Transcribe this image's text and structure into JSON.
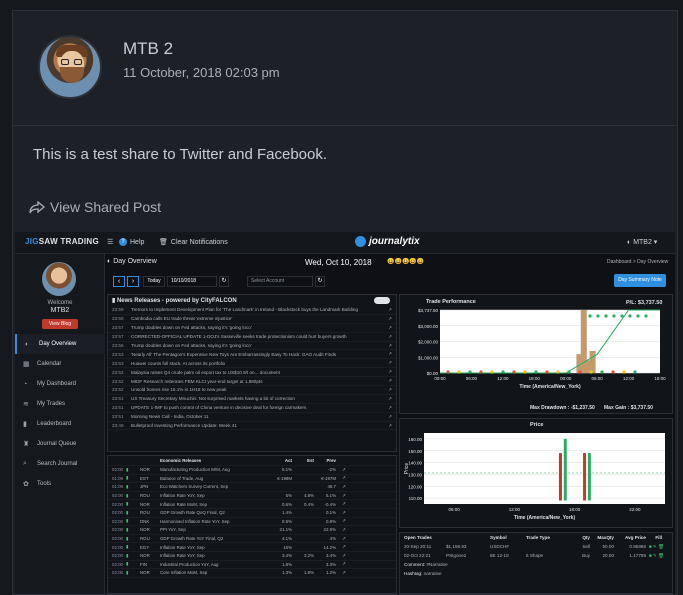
{
  "post": {
    "author": "MTB 2",
    "date": "11 October, 2018 02:03 pm",
    "message": "This is a test share to Twitter and Facebook.",
    "view_link": "View Shared Post"
  },
  "app": {
    "brand_a": "JIG",
    "brand_b": "SAW TRADING",
    "help": "Help",
    "clear": "Clear Notifications",
    "journal": "journalytix",
    "user": "MTB2"
  },
  "sidebar": {
    "welcome": "Welcome",
    "name": "MTB2",
    "btn": "View Blog",
    "items": [
      {
        "label": "Day Overview",
        "icon": "◐"
      },
      {
        "label": "Calendar",
        "icon": "▦"
      },
      {
        "label": "My Dashboard",
        "icon": "◔"
      },
      {
        "label": "My Trades",
        "icon": "≋"
      },
      {
        "label": "Leaderboard",
        "icon": "▮"
      },
      {
        "label": "Journal Queue",
        "icon": "♜"
      },
      {
        "label": "Search Journal",
        "icon": "⌕"
      },
      {
        "label": "Tools",
        "icon": "✿"
      }
    ]
  },
  "day": {
    "title": "Day Overview",
    "date": "Wed, Oct 10, 2018",
    "today": "Today",
    "date_input": "10/10/2018",
    "account_placeholder": "Select Account",
    "summary_btn": "Day Summary Note",
    "breadcrumb": "Dashboard > Day Overview",
    "emoji": "😀😀😀😀😀"
  },
  "news": {
    "title": "News Releases - powered by CityFALCON",
    "rows": [
      [
        "23:59",
        "Tremors to Implement Development Plan for 'The Landmark' in Ireland - Blackstock buys the Landmark Building"
      ],
      [
        "23:59",
        "Cambodia calls EU trade threat 'extreme injustice'"
      ],
      [
        "23:57",
        "Trump doubles down on Fed attacks, saying it's 'going loco'"
      ],
      [
        "23:57",
        "CORRECTED-OFFICIAL UPDATE 1-DOJ's Sasseville seeks trade protectionism could hurt buyers growth"
      ],
      [
        "23:56",
        "Trump doubles down on Fed attacks, saying it's 'going loco'"
      ],
      [
        "23:53",
        "'Nearly All' The Pentagon's Expensive New Toys Are Embarrassingly Easy To Hack: GAO Audit Finds"
      ],
      [
        "23:53",
        "Huawei counts full stack, AI across its portfolio"
      ],
      [
        "23:52",
        "Malaysia raises Q4 crude palm oil export tax to US$10.9/t on... document"
      ],
      [
        "23:52",
        "MIDF Research reiterates FBM KLCI year-end target at 1,880pts"
      ],
      [
        "23:52",
        "Unsold homes rise 16.1% in 1H18 to new peak"
      ],
      [
        "23:51",
        "US Treasury Secretary Mnuchin: Not surprised markets having a bit of correction"
      ],
      [
        "23:51",
        "UPDATE 1-IMF to push control of China venture in decisive deal for foreign carmakers"
      ],
      [
        "23:51",
        "Morning News Call - India, October 11"
      ],
      [
        "23:49",
        "Bulletproof Investing Performance Update: Week 41"
      ]
    ]
  },
  "econ": {
    "title": "Economic Releases",
    "cols": [
      "Act",
      "Est",
      "Prev"
    ],
    "rows": [
      [
        "02:00",
        "NOR",
        "Manufacturing Production M/M, Aug",
        "5.1%",
        "",
        "-2%"
      ],
      [
        "01:09",
        "EST",
        "Balance of Trade, Aug",
        "€-199M",
        "",
        "€-197M"
      ],
      [
        "01:09",
        "JPN",
        "Eco Watchers Survey Current, Sep",
        "",
        "",
        "46.7"
      ],
      [
        "02:00",
        "ROU",
        "Inflation Rate YoY, Sep",
        "5%",
        "4.8%",
        "5.1%"
      ],
      [
        "02:00",
        "NOR",
        "Inflation Rate MoM, Sep",
        "0.6%",
        "0.4%",
        "-0.4%"
      ],
      [
        "02:00",
        "ROU",
        "GDP Growth Rate QoQ Final, Q2",
        "1.4%",
        "",
        "0.1%"
      ],
      [
        "02:00",
        "DNK",
        "Harmonised Inflation Rate YoY, Sep",
        "0.5%",
        "",
        "0.8%"
      ],
      [
        "02:00",
        "NOR",
        "PPI YoY, Sep",
        "21.1%",
        "",
        "22.9%"
      ],
      [
        "02:00",
        "ROU",
        "GDP Growth Rate YoY Final, Q2",
        "4.1%",
        "",
        "4%"
      ],
      [
        "02:00",
        "EGY",
        "Inflation Rate YoY, Sep",
        "16%",
        "",
        "14.2%"
      ],
      [
        "02:00",
        "NOR",
        "Inflation Rate YoY, Sep",
        "3.4%",
        "3.2%",
        "3.4%"
      ],
      [
        "02:00",
        "FIN",
        "Industrial Production YoY, Aug",
        "1.8%",
        "",
        "3.3%"
      ],
      [
        "02:00",
        "NOR",
        "Core Inflation MoM, Sep",
        "1.3%",
        "1.8%",
        "1.2%"
      ]
    ]
  },
  "perf": {
    "title": "Trade Performance",
    "pnl_label": "P/L:",
    "pnl": "$3,737.50",
    "xlabel": "Time (America/New_York)",
    "max_dd_label": "Max Drawdown :",
    "max_dd": "-$1,237.50",
    "max_gain_label": "Max Gain :",
    "max_gain": "$3,737.50"
  },
  "price": {
    "title": "Price",
    "ylabel": "Price",
    "xlabel": "Time (America/New_York)"
  },
  "trades": {
    "title": "Open Trades",
    "cols": [
      "Symbol",
      "Trade Type",
      "",
      "Qty",
      "MaxQty",
      "Avg Price",
      "Fill"
    ],
    "rows": [
      [
        "20-Sep 20:11",
        "$1,156.93",
        "USDCHF",
        "",
        "Sell",
        "50.00",
        "50.00",
        "0.95866"
      ],
      [
        "02-Oct 22:21",
        "PSIgone2",
        "6E 12-18",
        "6 Shape",
        "Buy",
        "20.00",
        "20.00",
        "1.17795"
      ]
    ],
    "comment_label": "Comment:",
    "comment": "#Narrative",
    "hashtag_label": "Hashtag:",
    "hashtag": "narrative"
  },
  "chart_data": [
    {
      "type": "line",
      "title": "Trade Performance",
      "xlabel": "Time (America/New_York)",
      "x": [
        "00:00",
        "06:00",
        "12:00",
        "18:00",
        "00:00",
        "06:00",
        "12:00",
        "18:00"
      ],
      "ylabels": [
        "$3,737.50",
        "$3,000.00",
        "$2,000.00",
        "$1,000.00",
        "$0.00"
      ],
      "ylim": [
        0,
        3737.5
      ],
      "pnl_values": [
        0,
        0,
        0,
        0,
        0,
        1100,
        3737.5,
        3737.5
      ]
    },
    {
      "type": "bar",
      "title": "Price",
      "ylabel": "Price",
      "xlabel": "Time (America/New_York)",
      "yticks": [
        160,
        150,
        140,
        130,
        120,
        110
      ],
      "xticks": [
        "06:00",
        "12:00",
        "18:00",
        "22:00"
      ],
      "ylim": [
        105,
        165
      ]
    }
  ]
}
